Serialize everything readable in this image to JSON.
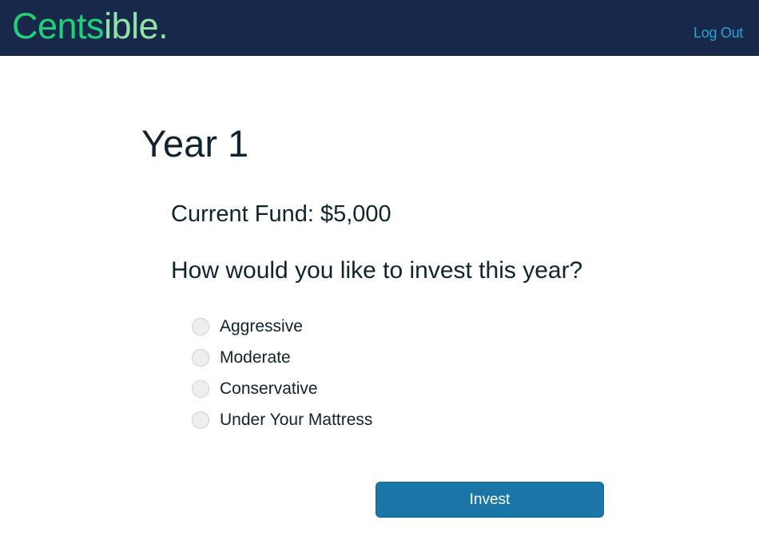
{
  "header": {
    "logo_part1": "Cents",
    "logo_part2": "ible.",
    "logout_label": "Log Out"
  },
  "main": {
    "title": "Year 1",
    "fund_text": "Current Fund: $5,000",
    "question": "How would you like to invest this year?",
    "options": [
      {
        "label": "Aggressive"
      },
      {
        "label": "Moderate"
      },
      {
        "label": "Conservative"
      },
      {
        "label": "Under Your Mattress"
      }
    ],
    "invest_label": "Invest"
  },
  "colors": {
    "navbar": "#17284b",
    "logo_primary": "#1fd17a",
    "logo_secondary": "#8fe3a6",
    "link": "#25a6d1",
    "button": "#1976a6"
  }
}
